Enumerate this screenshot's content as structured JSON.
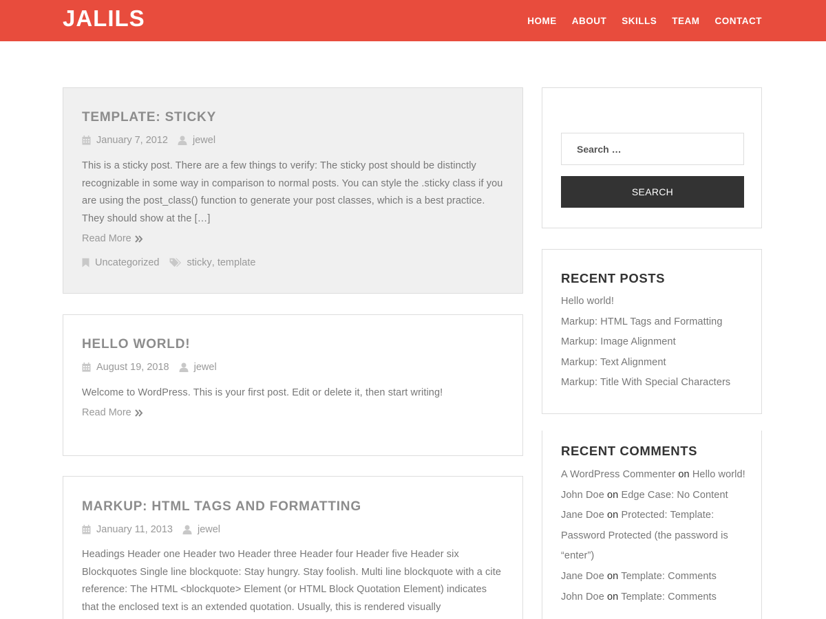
{
  "site": {
    "title": "JALILS"
  },
  "nav": [
    {
      "label": "HOME"
    },
    {
      "label": "ABOUT"
    },
    {
      "label": "SKILLS"
    },
    {
      "label": "TEAM"
    },
    {
      "label": "CONTACT"
    }
  ],
  "posts": [
    {
      "title": "TEMPLATE: STICKY",
      "date": "January 7, 2012",
      "author": "jewel",
      "excerpt": "This is a sticky post. There are a few things to verify: The sticky post should be distinctly recognizable in some way in comparison to normal posts. You can style the .sticky class if you are using the post_class() function to generate your post classes, which is a best practice. They should show at the […]",
      "read_more": "Read More",
      "category": "Uncategorized",
      "tag1": "sticky",
      "tag_sep": ",",
      "tag2": "template"
    },
    {
      "title": "HELLO WORLD!",
      "date": "August 19, 2018",
      "author": "jewel",
      "excerpt": "Welcome to WordPress. This is your first post. Edit or delete it, then start writing!",
      "read_more": "Read More"
    },
    {
      "title": "MARKUP: HTML TAGS AND FORMATTING",
      "date": "January 11, 2013",
      "author": "jewel",
      "excerpt": "Headings Header one Header two Header three Header four Header five Header six Blockquotes Single line blockquote: Stay hungry. Stay foolish. Multi line blockquote with a cite reference: The HTML <blockquote> Element (or HTML Block Quotation Element) indicates that the enclosed text is an extended quotation. Usually, this is rendered visually"
    }
  ],
  "search": {
    "placeholder": "Search …",
    "button": "SEARCH"
  },
  "recent_posts": {
    "title": "RECENT POSTS",
    "items": [
      "Hello world!",
      "Markup: HTML Tags and Formatting",
      "Markup: Image Alignment",
      "Markup: Text Alignment",
      "Markup: Title With Special Characters"
    ]
  },
  "recent_comments": {
    "title": "RECENT COMMENTS",
    "connector": "on",
    "items": [
      {
        "author": "A WordPress Commenter",
        "post": "Hello world!"
      },
      {
        "author": "John Doe",
        "post": "Edge Case: No Content"
      },
      {
        "author": "Jane Doe",
        "post": "Protected: Template: Password Protected (the password is “enter”)"
      },
      {
        "author": "Jane Doe",
        "post": "Template: Comments"
      },
      {
        "author": "John Doe",
        "post": "Template: Comments"
      }
    ]
  },
  "colors": {
    "accent": "#e84c3d",
    "button": "#333333",
    "sticky_bg": "#f0f0f0"
  },
  "icons": {
    "date": "calendar-icon",
    "author": "user-icon",
    "category": "bookmark-icon",
    "tags": "tags-icon",
    "read_more": "double-chevron-right-icon"
  }
}
